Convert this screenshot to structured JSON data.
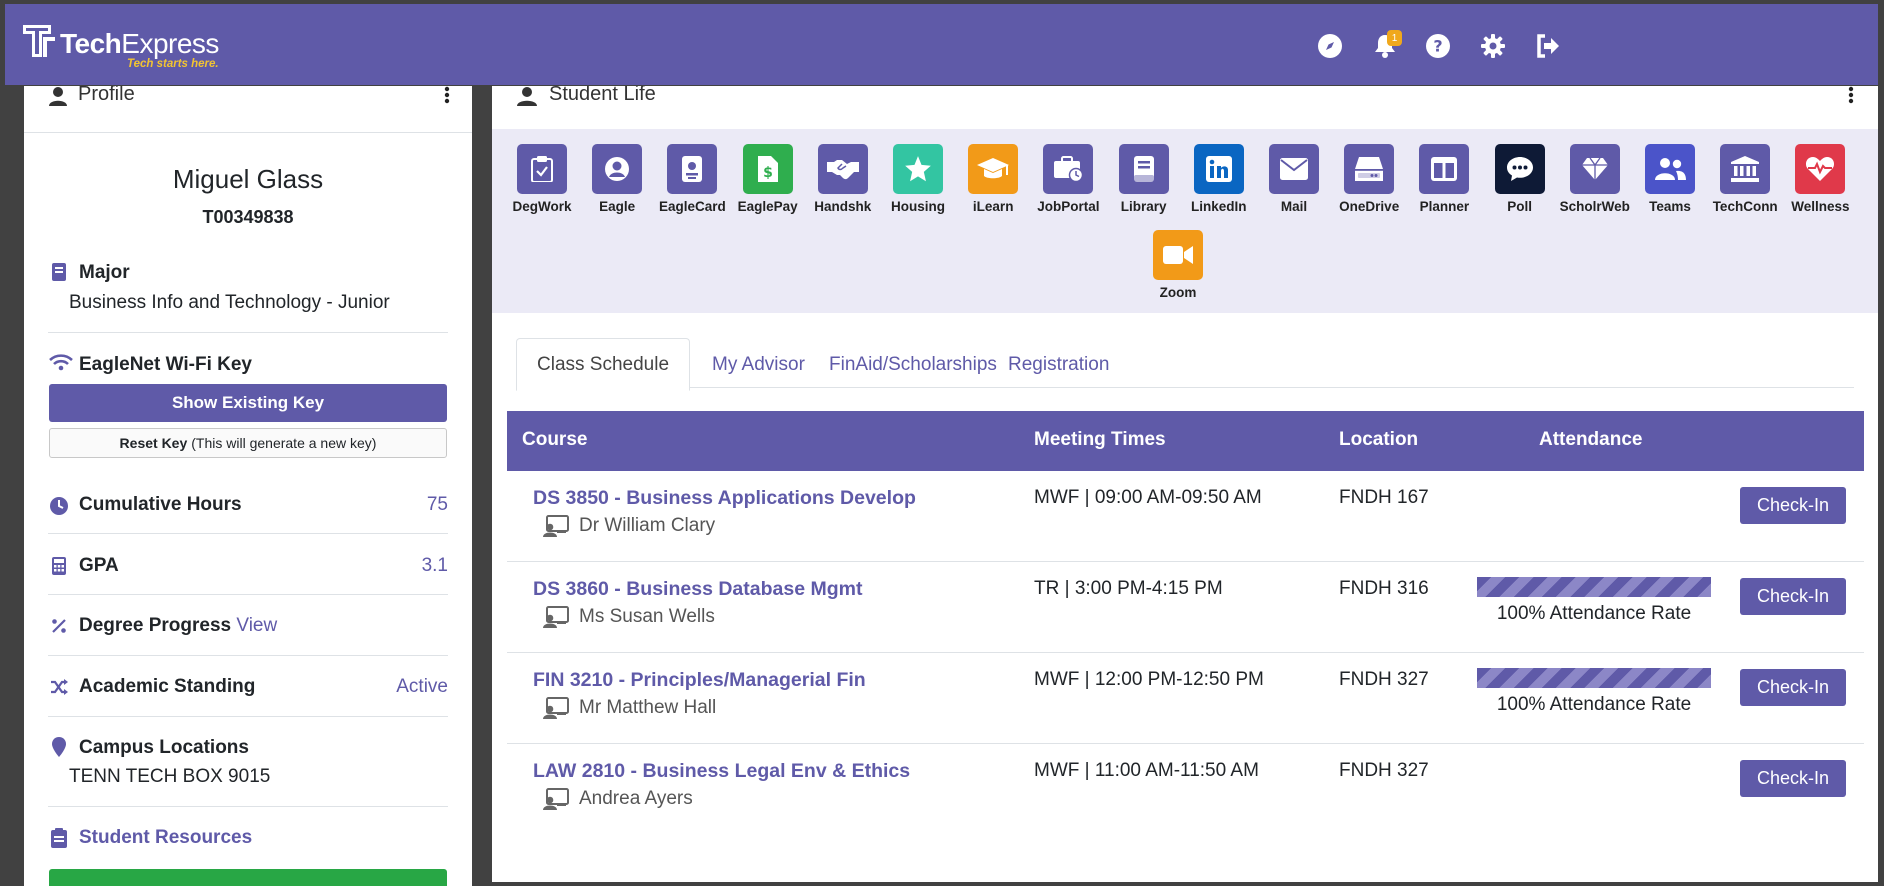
{
  "header": {
    "brand_main": "Tech",
    "brand_second": "Express",
    "tagline": "Tech starts here.",
    "notification_count": "1",
    "icons": [
      "compass-icon",
      "bell-icon",
      "help-icon",
      "gear-icon",
      "logout-icon"
    ],
    "colors": {
      "bar": "#5f5aa8",
      "accent": "#f2c432"
    }
  },
  "profile": {
    "title": "Profile",
    "name": "Miguel Glass",
    "student_id": "T00349838",
    "major_label": "Major",
    "major_value": "Business Info and Technology - Junior",
    "wifi_label": "EagleNet Wi-Fi Key",
    "show_key": "Show Existing Key",
    "reset_key": "Reset Key",
    "reset_note": "(This will generate a new key)",
    "hours_label": "Cumulative Hours",
    "hours_value": "75",
    "gpa_label": "GPA",
    "gpa_value": "3.1",
    "degree_label": "Degree Progress",
    "degree_link": "View",
    "standing_label": "Academic Standing",
    "standing_value": "Active",
    "campus_label": "Campus Locations",
    "campus_value": "TENN TECH BOX 9015",
    "resources_label": "Student Resources"
  },
  "student_life": {
    "title": "Student Life",
    "tiles": [
      {
        "label": "DegWork",
        "color": "#5f5aa8",
        "icon": "clipboard-check-icon"
      },
      {
        "label": "Eagle",
        "color": "#5f5aa8",
        "icon": "user-circle-icon"
      },
      {
        "label": "EagleCard",
        "color": "#5f5aa8",
        "icon": "id-badge-icon"
      },
      {
        "label": "EaglePay",
        "color": "#2fae4e",
        "icon": "dollar-file-icon"
      },
      {
        "label": "Handshk",
        "color": "#5f5aa8",
        "icon": "handshake-icon"
      },
      {
        "label": "Housing",
        "color": "#33c5a2",
        "icon": "star-icon"
      },
      {
        "label": "iLearn",
        "color": "#f29a18",
        "icon": "graduation-cap-icon"
      },
      {
        "label": "JobPortal",
        "color": "#5f5aa8",
        "icon": "briefcase-clock-icon"
      },
      {
        "label": "Library",
        "color": "#5f5aa8",
        "icon": "book-icon"
      },
      {
        "label": "LinkedIn",
        "color": "#0a66c2",
        "icon": "linkedin-icon"
      },
      {
        "label": "Mail",
        "color": "#5f5aa8",
        "icon": "envelope-icon"
      },
      {
        "label": "OneDrive",
        "color": "#5f5aa8",
        "icon": "hard-drive-icon"
      },
      {
        "label": "Planner",
        "color": "#5f5aa8",
        "icon": "columns-icon"
      },
      {
        "label": "Poll",
        "color": "#0e1a36",
        "icon": "chat-bubble-icon"
      },
      {
        "label": "ScholrWeb",
        "color": "#5f5aa8",
        "icon": "gem-icon"
      },
      {
        "label": "Teams",
        "color": "#4b54c9",
        "icon": "users-icon"
      },
      {
        "label": "TechConn",
        "color": "#5f5aa8",
        "icon": "institution-icon"
      },
      {
        "label": "Wellness",
        "color": "#e0394a",
        "icon": "heart-pulse-icon"
      },
      {
        "label": "Zoom",
        "color": "#f29a18",
        "icon": "video-camera-icon"
      }
    ]
  },
  "tabs": [
    "Class Schedule",
    "My Advisor",
    "FinAid/Scholarships",
    "Registration"
  ],
  "table": {
    "headers": [
      "Course",
      "Meeting Times",
      "Location",
      "Attendance"
    ],
    "check_in": "Check-In",
    "rows": [
      {
        "course": "DS 3850 - Business Applications Develop",
        "instructor": "Dr William Clary",
        "times": "MWF | 09:00 AM-09:50 AM",
        "location": "FNDH 167",
        "attendance": null,
        "attendance_text": ""
      },
      {
        "course": "DS 3860 - Business Database Mgmt",
        "instructor": "Ms Susan Wells",
        "times": "TR | 3:00 PM-4:15 PM",
        "location": "FNDH 316",
        "attendance": 100,
        "attendance_text": "100% Attendance Rate"
      },
      {
        "course": "FIN 3210 - Principles/Managerial Fin",
        "instructor": "Mr Matthew Hall",
        "times": "MWF | 12:00 PM-12:50 PM",
        "location": "FNDH 327",
        "attendance": 100,
        "attendance_text": "100% Attendance Rate"
      },
      {
        "course": "LAW 2810 - Business Legal Env & Ethics",
        "instructor": "Andrea Ayers",
        "times": "MWF | 11:00 AM-11:50 AM",
        "location": "FNDH 327",
        "attendance": null,
        "attendance_text": ""
      }
    ]
  }
}
